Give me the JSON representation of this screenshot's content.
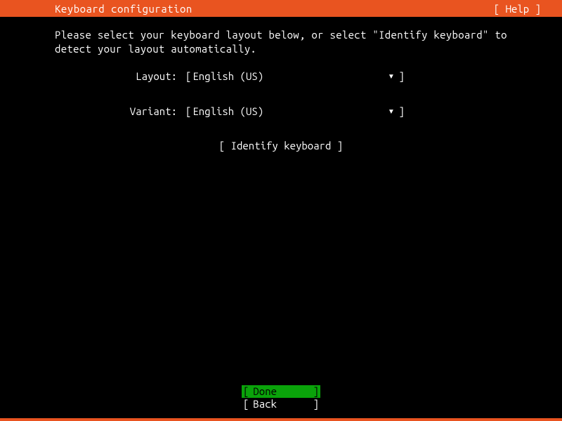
{
  "header": {
    "title": "Keyboard configuration",
    "help": "[ Help ]"
  },
  "instruction": "Please select your keyboard layout below, or select \"Identify keyboard\" to detect your layout automatically.",
  "form": {
    "layout": {
      "label": "Layout:",
      "value": "English (US)"
    },
    "variant": {
      "label": "Variant:",
      "value": "English (US)"
    }
  },
  "identify_label": "[ Identify keyboard ]",
  "footer": {
    "done": "Done",
    "back": "Back"
  },
  "brackets": {
    "open": "[",
    "close": "]"
  },
  "dropdown_arrow": "▾"
}
